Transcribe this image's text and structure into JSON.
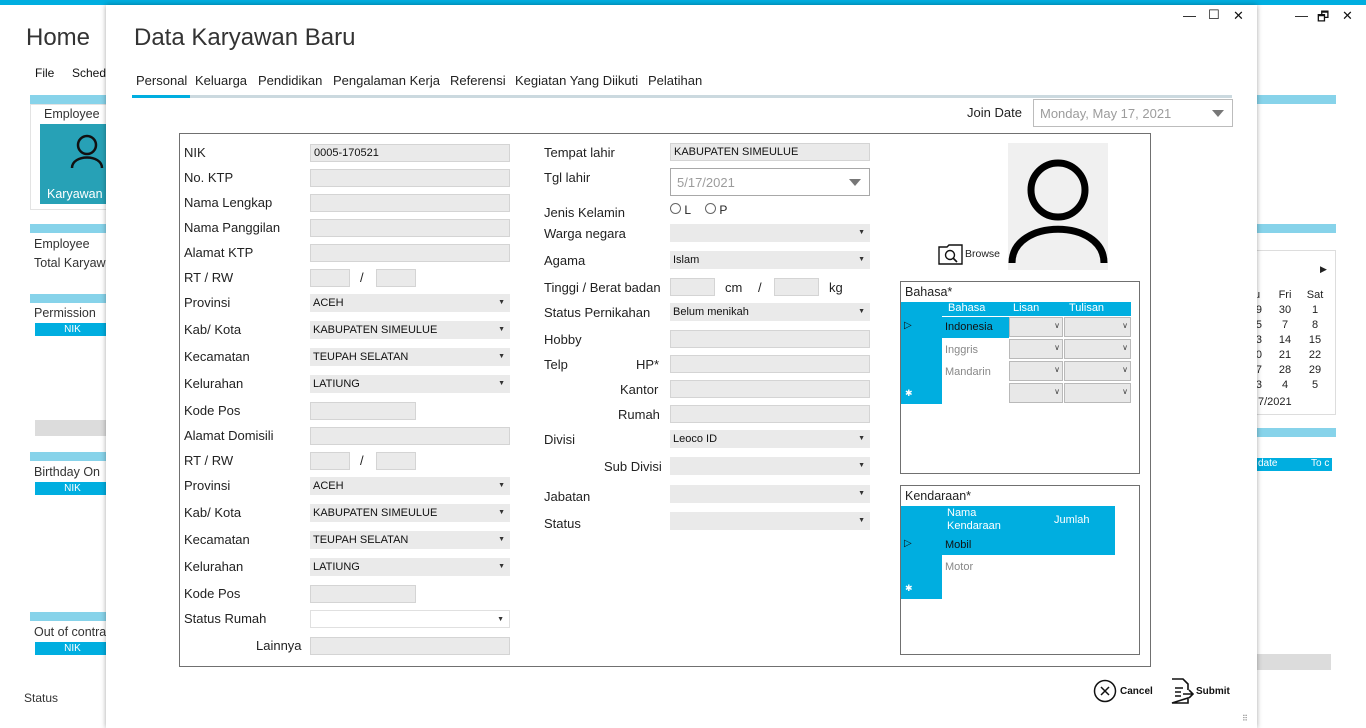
{
  "background": {
    "title": "Home",
    "menu": [
      "File",
      "Schedu"
    ],
    "employee_header": "Employee",
    "tile_label": "Karyawan",
    "summary": [
      "Employee",
      "Total Karyaw"
    ],
    "sections": [
      {
        "title": "Permission",
        "col": "NIK"
      },
      {
        "title": "Birthday On",
        "col": "NIK"
      },
      {
        "title": "Out of contra",
        "col": "NIK"
      }
    ],
    "status": "Status",
    "calendar": {
      "days": [
        "Fri",
        "Sat"
      ],
      "rows": [
        [
          "9",
          "30",
          "1"
        ],
        [
          "5",
          "7",
          "8"
        ],
        [
          "3",
          "14",
          "15"
        ],
        [
          "0",
          "21",
          "22"
        ],
        [
          "7",
          "28",
          "29"
        ],
        [
          "3",
          "4",
          "5"
        ]
      ],
      "footer": "7/2021"
    },
    "grid_cols": [
      "date",
      "To c"
    ]
  },
  "modal": {
    "title": "Data Karyawan Baru",
    "window_controls": [
      "—",
      "☐",
      "✕"
    ],
    "outer_controls": [
      "—",
      "🗗",
      "✕"
    ],
    "tabs": [
      "Personal",
      "Keluarga",
      "Pendidikan",
      "Pengalaman Kerja",
      "Referensi",
      "Kegiatan Yang Diikuti",
      "Pelatihan"
    ],
    "join_date_label": "Join Date",
    "join_date_value": "Monday, May 17, 2021",
    "left": {
      "nik_label": "NIK",
      "nik_value": "0005-170521",
      "ktp_label": "No. KTP",
      "nama_lengkap_label": "Nama Lengkap",
      "nama_panggilan_label": "Nama Panggilan",
      "alamat_ktp_label": "Alamat KTP",
      "rtrw_label": "RT / RW",
      "slash": "/",
      "provinsi_label": "Provinsi",
      "provinsi_value": "ACEH",
      "kabkota_label": "Kab/ Kota",
      "kabkota_value": "KABUPATEN SIMEULUE",
      "kecamatan_label": "Kecamatan",
      "kecamatan_value": "TEUPAH SELATAN",
      "kelurahan_label": "Kelurahan",
      "kelurahan_value": "LATIUNG",
      "kodepos_label": "Kode Pos",
      "alamat_domisili_label": "Alamat Domisili",
      "status_rumah_label": "Status Rumah",
      "lainnya_label": "Lainnya"
    },
    "middle": {
      "tempat_lahir_label": "Tempat lahir",
      "tempat_lahir_value": "KABUPATEN SIMEULUE",
      "tgl_lahir_label": "Tgl lahir",
      "tgl_lahir_value": "5/17/2021",
      "jenis_kelamin_label": "Jenis Kelamin",
      "gender_l": "L",
      "gender_p": "P",
      "warga_label": "Warga negara",
      "agama_label": "Agama",
      "agama_value": "Islam",
      "tinggi_label": "Tinggi / Berat badan",
      "cm": "cm",
      "kg": "kg",
      "pernikahan_label": "Status Pernikahan",
      "pernikahan_value": "Belum menikah",
      "hobby_label": "Hobby",
      "telp_label": "Telp",
      "hp_label": "HP*",
      "kantor_label": "Kantor",
      "rumah_label": "Rumah",
      "divisi_label": "Divisi",
      "divisi_value": "Leoco ID",
      "subdivisi_label": "Sub Divisi",
      "jabatan_label": "Jabatan",
      "status_label": "Status"
    },
    "photo": {
      "browse_label": "Browse"
    },
    "bahasa": {
      "title": "Bahasa*",
      "headers": [
        "Bahasa",
        "Lisan",
        "Tulisan"
      ],
      "rows": [
        "Indonesia",
        "Inggris",
        "Mandarin"
      ]
    },
    "kendaraan": {
      "title": "Kendaraan*",
      "headers": [
        "Nama Kendaraan",
        "Jumlah"
      ],
      "rows": [
        "Mobil",
        "Motor"
      ]
    },
    "buttons": {
      "cancel": "Cancel",
      "submit": "Submit"
    }
  }
}
